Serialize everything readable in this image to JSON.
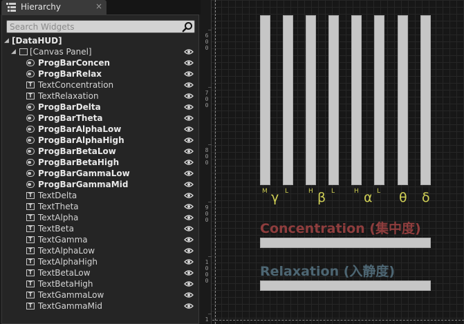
{
  "tab": {
    "title": "Hierarchy",
    "close_glyph": "×"
  },
  "search": {
    "placeholder": "Search Widgets"
  },
  "tree": {
    "root": "[DataHUD]",
    "canvas": "[Canvas Panel]",
    "items": [
      {
        "label": "ProgBarConcen",
        "kind": "progressbar"
      },
      {
        "label": "ProgBarRelax",
        "kind": "progressbar"
      },
      {
        "label": "TextConcentration",
        "kind": "text"
      },
      {
        "label": "TextRelaxation",
        "kind": "text"
      },
      {
        "label": "ProgBarDelta",
        "kind": "progressbar"
      },
      {
        "label": "ProgBarTheta",
        "kind": "progressbar"
      },
      {
        "label": "ProgBarAlphaLow",
        "kind": "progressbar"
      },
      {
        "label": "ProgBarAlphaHigh",
        "kind": "progressbar"
      },
      {
        "label": "ProgBarBetaLow",
        "kind": "progressbar"
      },
      {
        "label": "ProgBarBetaHigh",
        "kind": "progressbar"
      },
      {
        "label": "ProgBarGammaLow",
        "kind": "progressbar"
      },
      {
        "label": "ProgBarGammaMid",
        "kind": "progressbar"
      },
      {
        "label": "TextDelta",
        "kind": "text"
      },
      {
        "label": "TextTheta",
        "kind": "text"
      },
      {
        "label": "TextAlpha",
        "kind": "text"
      },
      {
        "label": "TextBeta",
        "kind": "text"
      },
      {
        "label": "TextGamma",
        "kind": "text"
      },
      {
        "label": "TextAlphaLow",
        "kind": "text"
      },
      {
        "label": "TextAlphaHigh",
        "kind": "text"
      },
      {
        "label": "TextBetaLow",
        "kind": "text"
      },
      {
        "label": "TextBetaHigh",
        "kind": "text"
      },
      {
        "label": "TextGammaLow",
        "kind": "text"
      },
      {
        "label": "TextGammaMid",
        "kind": "text"
      }
    ]
  },
  "ruler": {
    "labels": [
      "600",
      "700",
      "800",
      "900",
      "1000",
      "1"
    ]
  },
  "designer": {
    "wave_symbols": {
      "gamma_mid": "M",
      "gamma": "γ",
      "gamma_low": "L",
      "beta_high": "H",
      "beta": "β",
      "beta_low": "L",
      "alpha_high": "H",
      "alpha": "α",
      "alpha_low": "L",
      "theta": "θ",
      "delta": "δ"
    },
    "concentration_label": "Concentration (集中度)",
    "relaxation_label": "Relaxation (入静度)"
  },
  "colors": {
    "concentration_text": "#8e3d3d",
    "relaxation_text": "#4d6673",
    "wave_symbol": "#cfcf55",
    "bar_fill": "#c6c6c6",
    "search_bg": "#d2d2d2"
  },
  "icons": {
    "tab": "hierarchy-tree-icon",
    "search": "magnifier-icon",
    "visibility": "eye-icon",
    "progressbar": "progressbar-widget-icon",
    "text": "text-widget-icon",
    "canvas": "canvas-panel-icon"
  }
}
